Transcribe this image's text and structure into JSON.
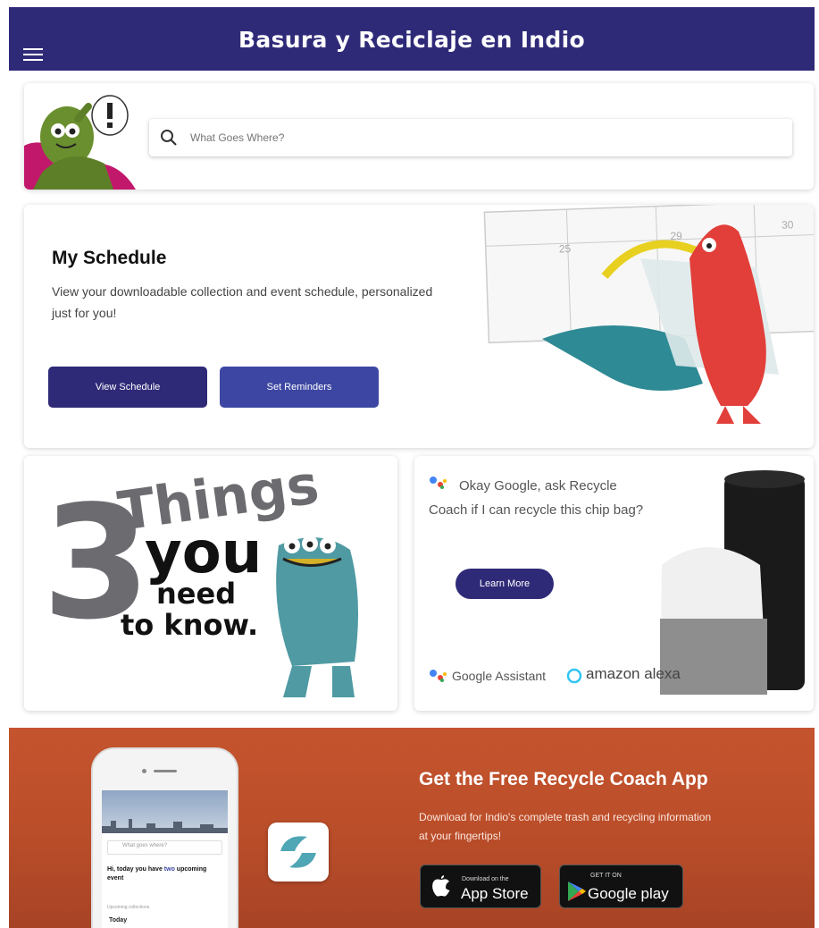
{
  "header": {
    "title": "Basura y Reciclaje en Indio",
    "menu_icon": "hamburger-menu-icon",
    "background_color": "#2f2a78"
  },
  "search": {
    "placeholder": "What Goes Where?",
    "icon": "search-icon"
  },
  "schedule": {
    "title": "My Schedule",
    "description": "View your downloadable collection and event schedule, personalized just for you!",
    "view_button": "View Schedule",
    "reminders_button": "Set Reminders",
    "calendar_days": [
      "25",
      "29",
      "30"
    ]
  },
  "things_card": {
    "number": "3",
    "line1": "Things",
    "line2": "you",
    "line3": "need",
    "line4": "to know."
  },
  "voice_card": {
    "prompt": "Okay Google, ask Recycle Coach if I can recycle this chip bag?",
    "learn_more_button": "Learn More",
    "google_assistant_label": "Google Assistant",
    "alexa_label": "amazon alexa"
  },
  "promo": {
    "title": "Get the Free Recycle Coach App",
    "description": "Download for Indio's complete trash and recycling information at your fingertips!",
    "app_store": {
      "small": "Download on the",
      "big": "App Store"
    },
    "google_play": {
      "small": "GET IT ON",
      "big": "Google play"
    },
    "phone": {
      "search": "What goes where?",
      "greeting_start": "Hi, today you have ",
      "greeting_highlight": "two",
      "greeting_end": " upcoming event",
      "upcoming_label": "Upcoming collections",
      "today_label": "Today"
    }
  },
  "colors": {
    "brand_purple": "#2f2a78",
    "button_blue": "#3d47a3",
    "promo_orange": "#c4542e"
  }
}
